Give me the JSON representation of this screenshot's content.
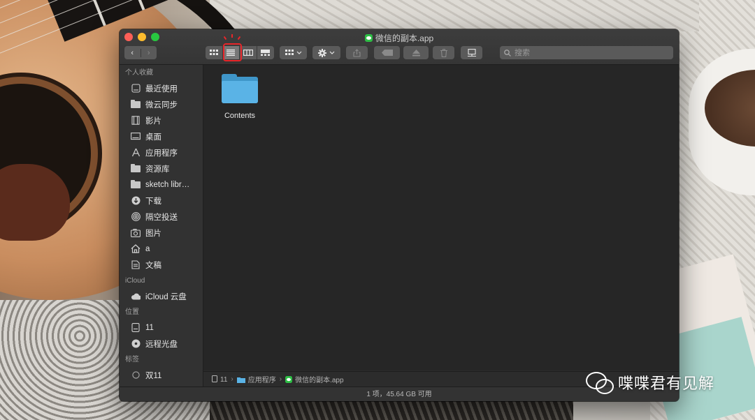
{
  "window": {
    "title": "微信的副本.app",
    "app_icon": "wechat-app-icon"
  },
  "toolbar": {
    "back_icon": "‹",
    "forward_icon": "›",
    "view_modes": [
      "icon-view",
      "list-view",
      "column-view",
      "gallery-view"
    ],
    "active_view": "list-view",
    "search_placeholder": "搜索"
  },
  "sidebar": {
    "favorites_header": "个人收藏",
    "favorites": [
      {
        "label": "最近使用",
        "icon": "recents-icon"
      },
      {
        "label": "微云同步",
        "icon": "folder-icon"
      },
      {
        "label": "影片",
        "icon": "movies-icon"
      },
      {
        "label": "桌面",
        "icon": "desktop-icon"
      },
      {
        "label": "应用程序",
        "icon": "applications-icon"
      },
      {
        "label": "资源库",
        "icon": "folder-icon"
      },
      {
        "label": "sketch libr…",
        "icon": "folder-icon"
      },
      {
        "label": "下载",
        "icon": "downloads-icon"
      },
      {
        "label": "隔空投送",
        "icon": "airdrop-icon"
      },
      {
        "label": "图片",
        "icon": "pictures-icon"
      },
      {
        "label": "a",
        "icon": "home-icon"
      },
      {
        "label": "文稿",
        "icon": "documents-icon"
      }
    ],
    "icloud_header": "iCloud",
    "icloud": [
      {
        "label": "iCloud 云盘",
        "icon": "cloud-icon"
      }
    ],
    "locations_header": "位置",
    "locations": [
      {
        "label": "11",
        "icon": "disk-icon"
      },
      {
        "label": "远程光盘",
        "icon": "remote-disc-icon"
      }
    ],
    "tags_header": "标签",
    "tags": [
      {
        "label": "双11",
        "icon": "tag-circle-icon"
      }
    ]
  },
  "content": {
    "items": [
      {
        "name": "Contents",
        "icon": "folder-icon"
      }
    ]
  },
  "pathbar": {
    "segments": [
      "11",
      "应用程序",
      "微信的副本.app"
    ]
  },
  "statusbar": {
    "text": "1 项，45.64 GB 可用"
  },
  "watermark": {
    "text": "喋喋君有见解"
  },
  "colors": {
    "close": "#fc5f57",
    "minimize": "#fdbc2e",
    "zoom": "#28c840",
    "folder_blue": "#5ab3e6",
    "highlight_red": "#e8262a"
  }
}
